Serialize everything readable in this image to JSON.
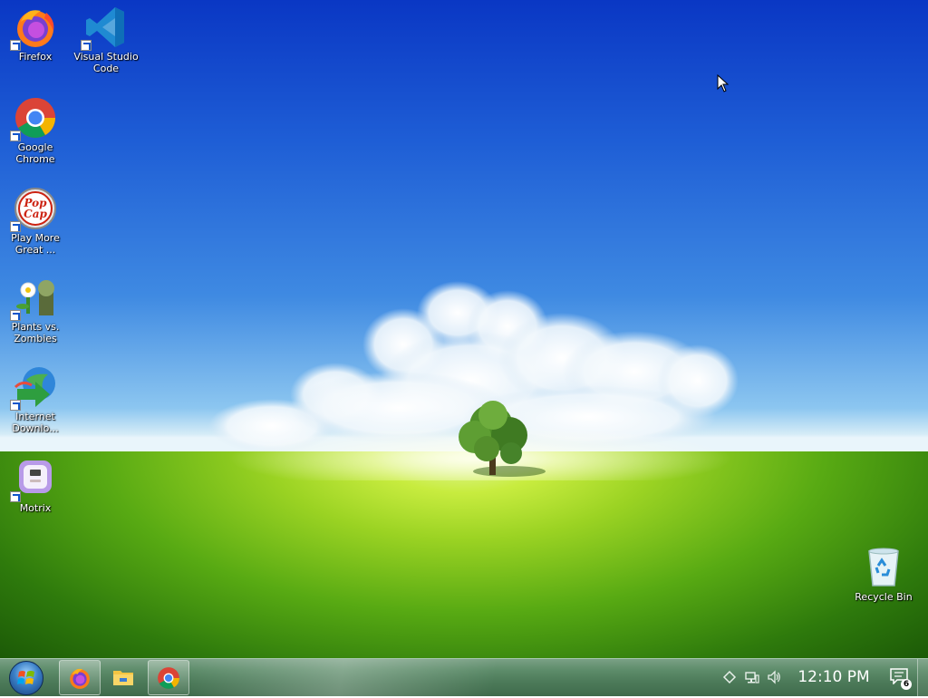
{
  "desktop": {
    "icons": [
      {
        "label": "Firefox",
        "icon": "firefox-icon"
      },
      {
        "label": "Visual Studio Code",
        "icon": "vscode-icon"
      },
      {
        "label": "Google Chrome",
        "icon": "chrome-icon"
      },
      {
        "label": "Play More Great ...",
        "icon": "popcap-icon"
      },
      {
        "label": "Plants vs. Zombies",
        "icon": "plants-vs-zombies-icon"
      },
      {
        "label": "Internet Downlo...",
        "icon": "internet-download-manager-icon"
      },
      {
        "label": "Motrix",
        "icon": "motrix-icon"
      },
      {
        "label": "Recycle Bin",
        "icon": "recycle-bin-icon"
      }
    ]
  },
  "taskbar": {
    "start_icon": "windows-start-icon",
    "pinned": [
      {
        "icon": "firefox-icon",
        "active": true
      },
      {
        "icon": "file-explorer-icon",
        "active": false
      },
      {
        "icon": "chrome-icon",
        "active": true
      }
    ],
    "tray": {
      "icons": [
        "tray-overflow-icon",
        "network-icon",
        "volume-icon"
      ],
      "clock": "12:10 PM",
      "notification_count": "6"
    }
  }
}
